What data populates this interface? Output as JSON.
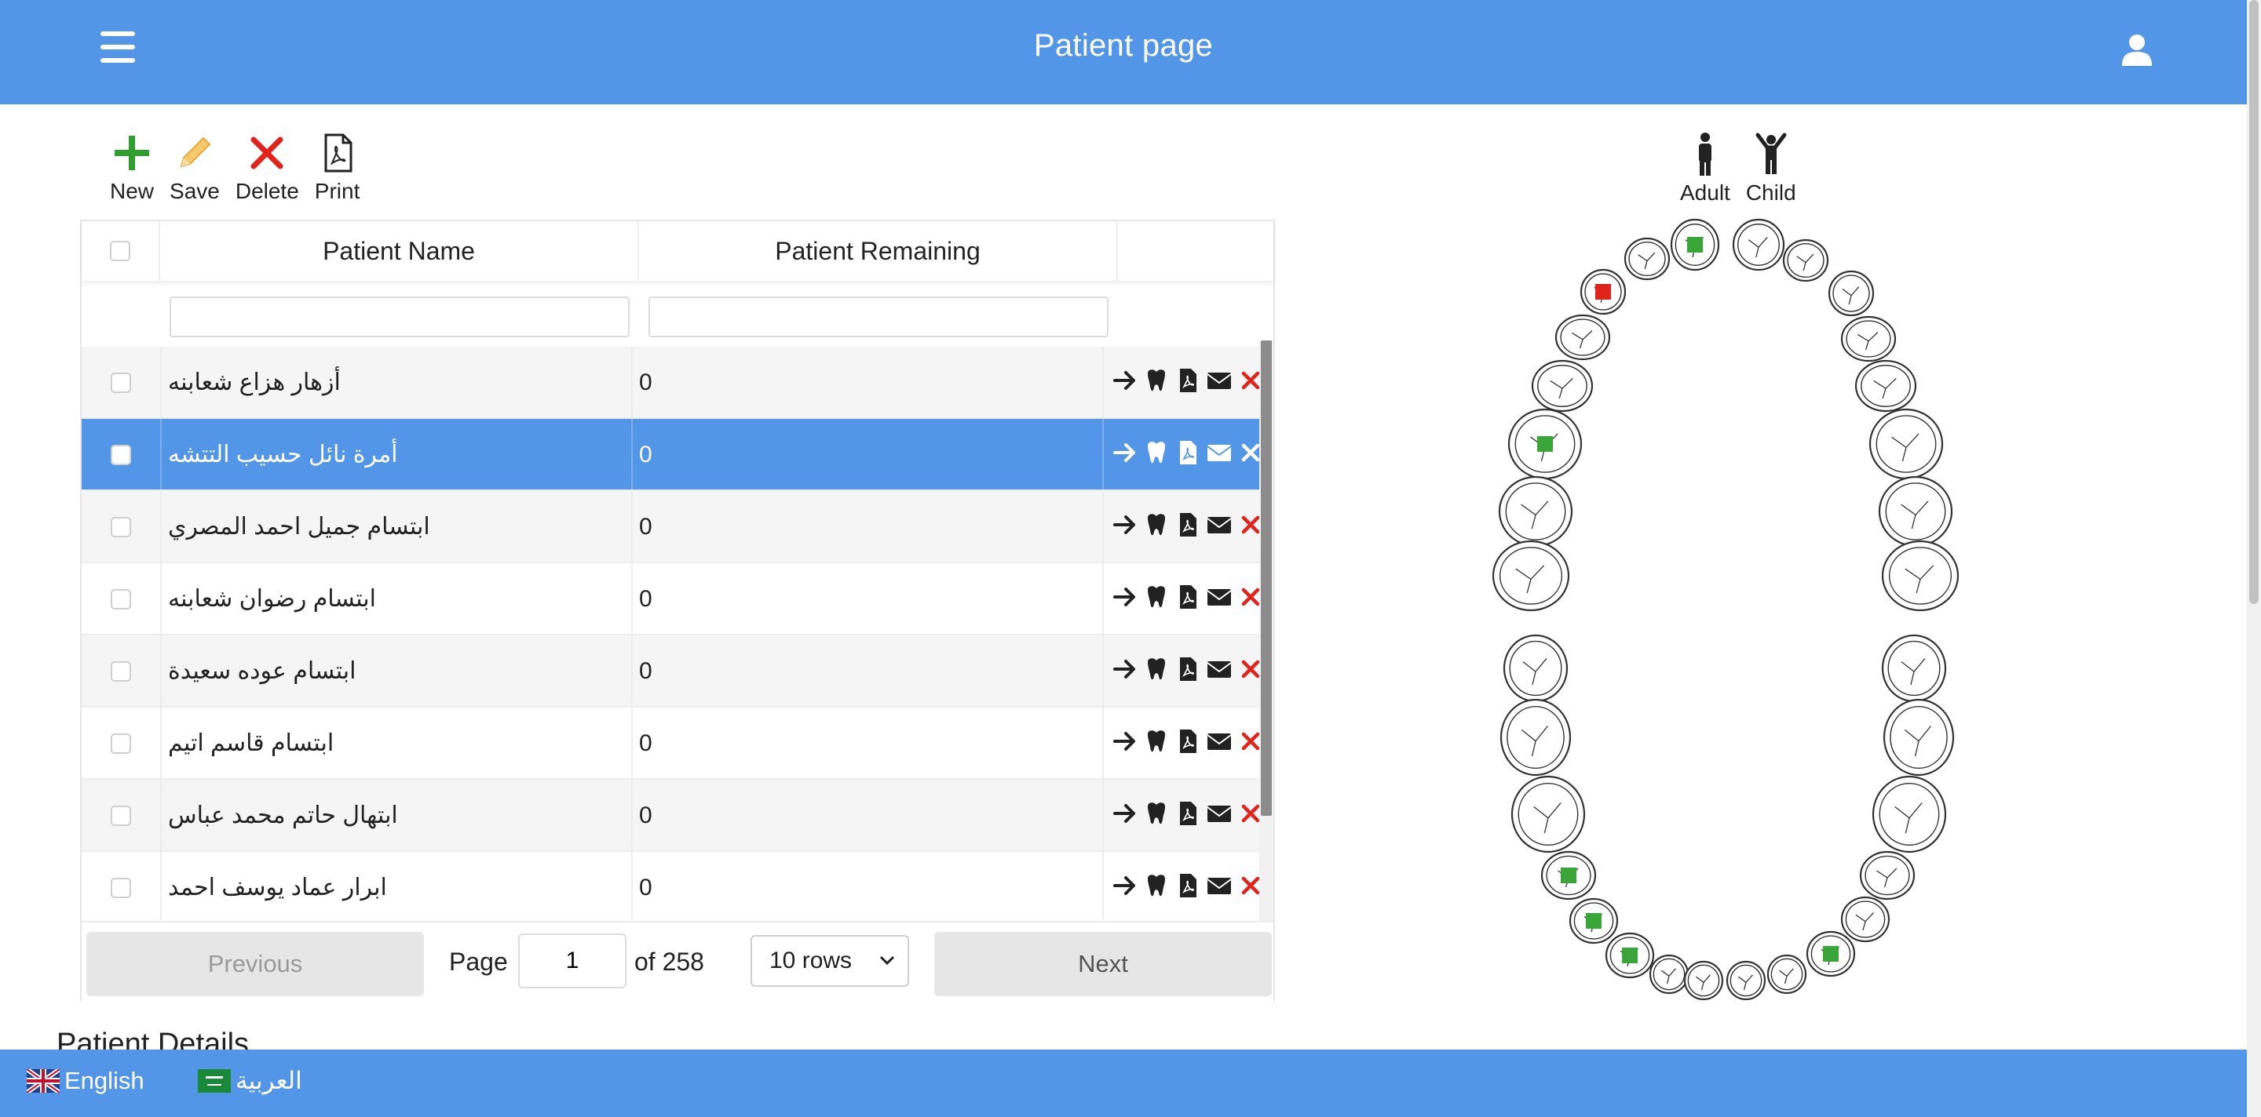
{
  "header": {
    "title": "Patient page"
  },
  "toolbar": {
    "new_label": "New",
    "save_label": "Save",
    "delete_label": "Delete",
    "print_label": "Print",
    "colors": {
      "new": "#2e9e2e",
      "save": "#f0b64a",
      "delete": "#e0241c",
      "print": "#222222"
    }
  },
  "table": {
    "columns": [
      "Patient Name",
      "Patient Remaining"
    ],
    "filters": {
      "name": "",
      "remaining": ""
    },
    "rows": [
      {
        "name": "أزهار هزاع شعابنه",
        "remaining": "0",
        "selected": false
      },
      {
        "name": "أمرة نائل حسيب التتشه",
        "remaining": "0",
        "selected": true
      },
      {
        "name": "ابتسام جميل احمد المصري",
        "remaining": "0",
        "selected": false
      },
      {
        "name": "ابتسام رضوان شعابنه",
        "remaining": "0",
        "selected": false
      },
      {
        "name": "ابتسام عوده سعيدة",
        "remaining": "0",
        "selected": false
      },
      {
        "name": "ابتسام قاسم اتيم",
        "remaining": "0",
        "selected": false
      },
      {
        "name": "ابتهال حاتم محمد عباس",
        "remaining": "0",
        "selected": false
      },
      {
        "name": "ابرار عماد يوسف احمد",
        "remaining": "0",
        "selected": false
      }
    ],
    "row_actions": [
      "arrow-right-icon",
      "tooth-icon",
      "pdf-icon",
      "envelope-icon",
      "close-icon"
    ]
  },
  "pagination": {
    "previous_label": "Previous",
    "next_label": "Next",
    "page_label": "Page",
    "current_page": "1",
    "of_label": "of 258",
    "rows_option": "10 rows"
  },
  "details": {
    "title": "Patient Details"
  },
  "teeth_chart": {
    "adult_label": "Adult",
    "child_label": "Child",
    "marker_colors": {
      "green": "#3aa63a",
      "red": "#e0241c"
    }
  },
  "footer": {
    "english_label": "English",
    "arabic_label": "العربية"
  },
  "accent_color": "#5396e8"
}
